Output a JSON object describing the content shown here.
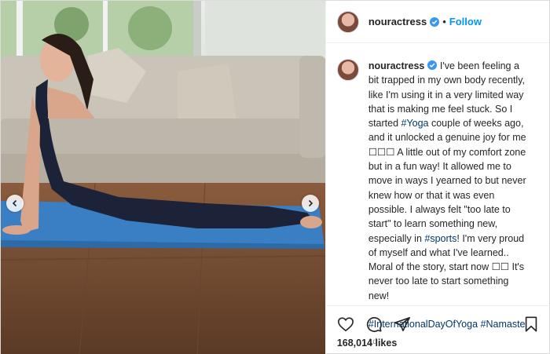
{
  "post": {
    "username": "nouractress",
    "follow_label": "Follow",
    "separator": "•",
    "caption": {
      "username": "nouractress",
      "part1": " I've been feeling a bit trapped in my own body recently, like I'm using it in a very limited way that is making me feel stuck. So I started ",
      "tag_yoga": "#Yoga",
      "part2": " couple of weeks ago, and it unlocked a genuine joy for me ☐☐☐ A little out of my comfort zone but in a fun way! It allowed me to move in ways I yearned to but never knew how or that it was even possible. I always felt \"too late to start\" to learn something new, especially in ",
      "tag_sports": "#sports",
      "part3": "! I'm very proud of myself and what I've learned.. Moral of the story, start now ☐☐ It's never too late to start something new!",
      "tag_international": "#InternationalDayOfYoga",
      "tag_namaste": "#Namaste"
    },
    "time_ago": "1d",
    "likes": "168,014 likes"
  },
  "icons": {
    "heart": "heart-icon",
    "comment": "comment-icon",
    "share": "share-icon",
    "save": "bookmark-icon",
    "verified": "verified-badge-icon",
    "prev": "chevron-left-icon",
    "next": "chevron-right-icon"
  },
  "colors": {
    "link_blue": "#0095f6",
    "hashtag": "#00376b",
    "muted": "#8e8e8e"
  }
}
